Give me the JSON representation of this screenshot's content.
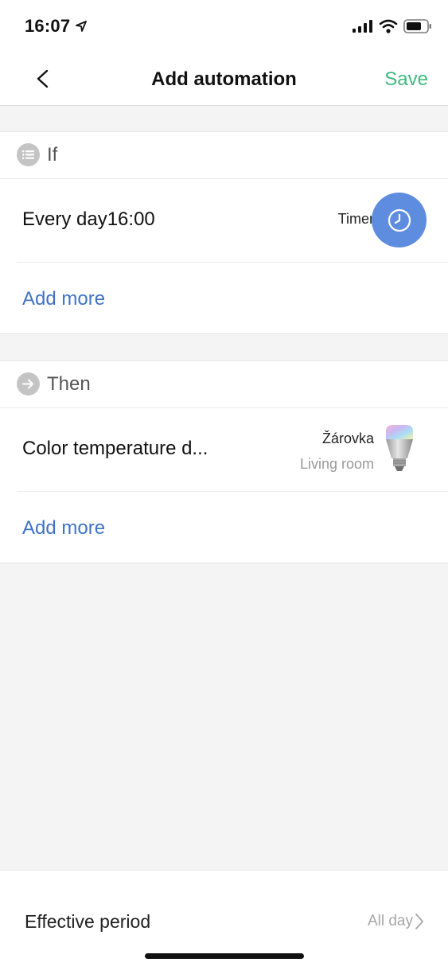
{
  "status": {
    "time": "16:07"
  },
  "nav": {
    "title": "Add automation",
    "save_label": "Save"
  },
  "if_section": {
    "title": "If",
    "condition": "Every day16:00",
    "type_label": "Timer",
    "add_more": "Add more"
  },
  "then_section": {
    "title": "Then",
    "action": "Color temperature d...",
    "device_name": "Žárovka",
    "device_room": "Living room",
    "add_more": "Add more"
  },
  "effective": {
    "label": "Effective period",
    "value": "All day"
  },
  "colors": {
    "accent_green": "#3fba80",
    "link_blue": "#3f72c6",
    "timer_blue": "#5e8de0"
  }
}
